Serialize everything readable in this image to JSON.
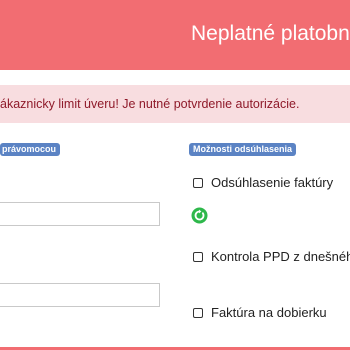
{
  "header": {
    "title": "Neplatné platobn",
    "color": "#f26d72"
  },
  "alert": {
    "text": "ákaznicky limit úveru! Je nutné potvrdenie autorizácie."
  },
  "left_section": {
    "badge": " právomocou",
    "field1_value": "",
    "field2_value": ""
  },
  "right_section": {
    "badge": "Možnosti odsúhlasenia",
    "options": [
      {
        "label": "Odsúhlasenie faktúry",
        "checked": false
      },
      {
        "label": "Kontrola PPD z dnešného",
        "checked": false
      },
      {
        "label": "Faktúra na dobierku",
        "checked": false
      }
    ],
    "status_icon": "refresh-check-icon"
  }
}
